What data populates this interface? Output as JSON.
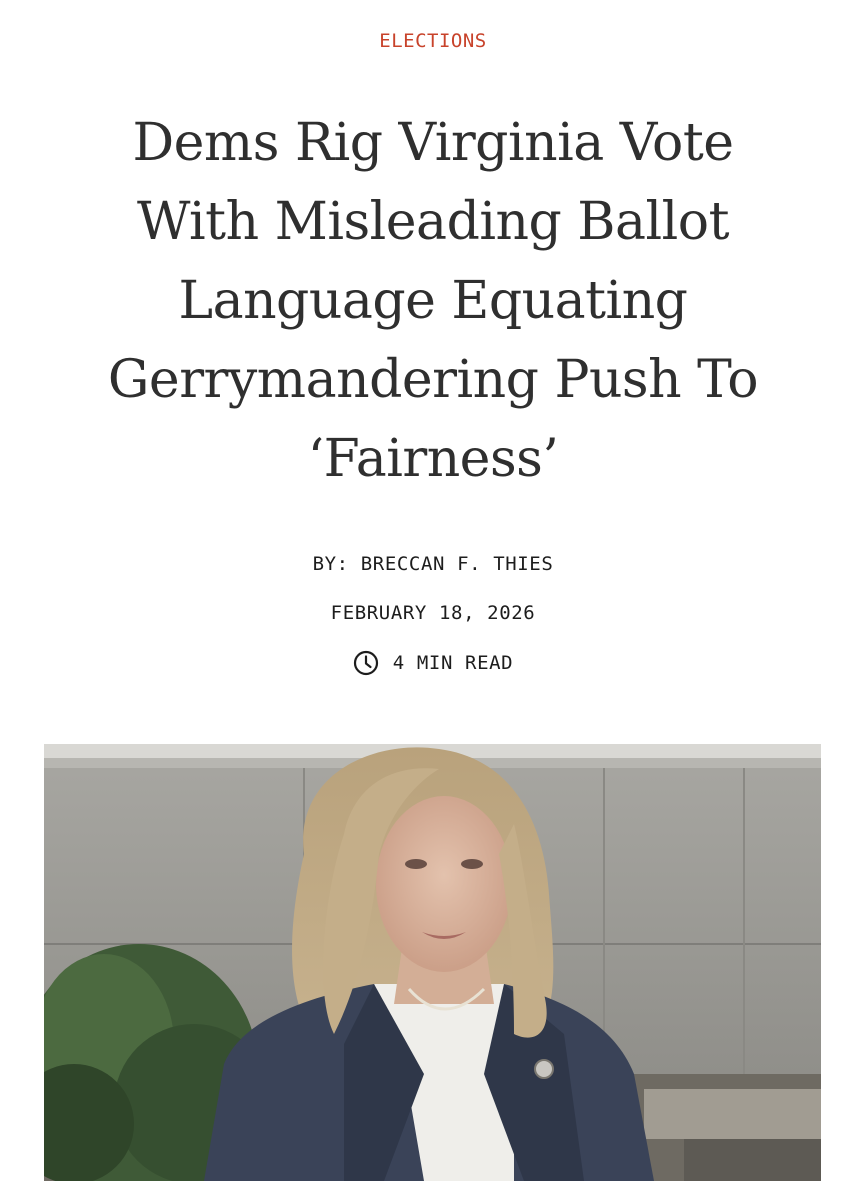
{
  "article": {
    "category": "ELECTIONS",
    "headline_lines": [
      "Dems Rig Virginia Vote",
      "With Misleading Ballot",
      "Language Equating",
      "Gerrymandering Push To",
      "‘Fairness’"
    ],
    "byline_prefix": "BY:",
    "author": "BRECCAN F. THIES",
    "date": "FEBRUARY 18, 2026",
    "read_time": "4 MIN READ",
    "read_time_icon": "clock-icon"
  },
  "colors": {
    "category": "#c8432b",
    "headline": "#2f2f2f",
    "meta": "#1d1d1d"
  }
}
